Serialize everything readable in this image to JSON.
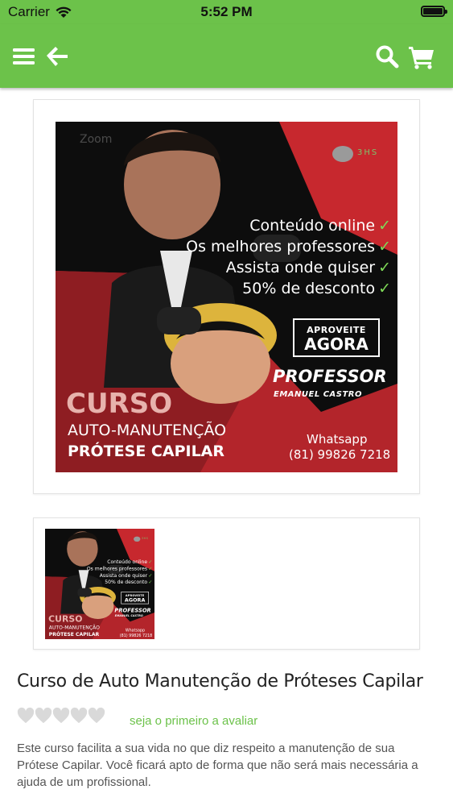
{
  "status_bar": {
    "carrier": "Carrier",
    "time": "5:52 PM"
  },
  "nav": {
    "accent_color": "#6cc24a",
    "icons": [
      "menu-icon",
      "back-arrow-icon",
      "search-icon",
      "cart-icon"
    ]
  },
  "product_image": {
    "watermark": "Zoom",
    "logo_text": "3HS",
    "lines": [
      "Conteúdo online",
      "Os melhores professores",
      "Assista onde quiser",
      "50% de desconto"
    ],
    "cta_small": "APROVEITE",
    "cta_big": "AGORA",
    "professor_label": "PROFESSOR",
    "professor_name": "EMANUEL CASTRO",
    "curso": "CURSO",
    "auto": "AUTO-MANUTENÇÃO",
    "protese": "PRÓTESE CAPILAR",
    "whatsapp_label": "Whatsapp",
    "phone": "(81) 99826 7218"
  },
  "product": {
    "title": "Curso de Auto Manutenção de Próteses Capilar",
    "rating_link": "seja o primeiro a avaliar",
    "description": "Este curso facilita a sua vida no que diz respeito a manutenção de sua Prótese Capilar. Você ficará apto de forma que não será mais necessária a ajuda de um profissional."
  }
}
